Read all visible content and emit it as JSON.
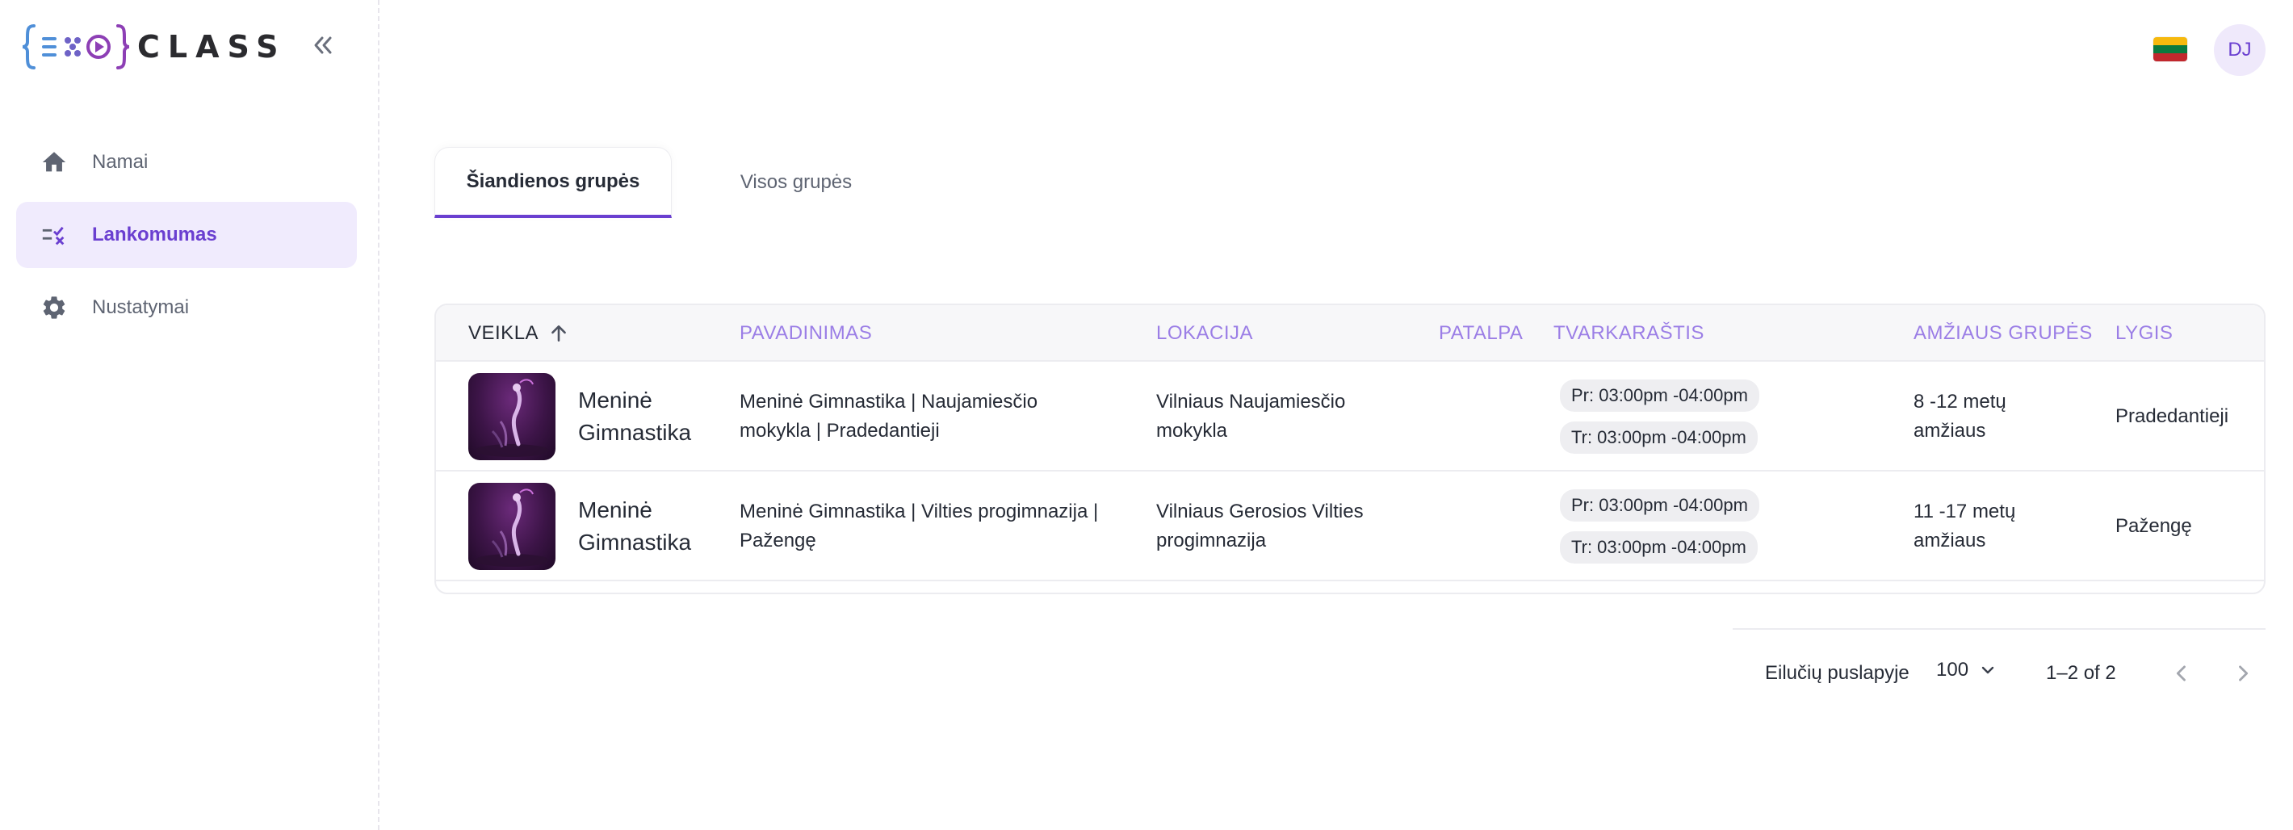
{
  "brand": {
    "logo_text": "CLASS",
    "colors": {
      "blue": "#4f8fd8",
      "purple": "#8d3fb5",
      "dark": "#2b2b2f"
    }
  },
  "sidebar": {
    "items": [
      {
        "label": "Namai",
        "icon": "home-icon",
        "active": false
      },
      {
        "label": "Lankomumas",
        "icon": "attendance-icon",
        "active": true
      },
      {
        "label": "Nustatymai",
        "icon": "gear-icon",
        "active": false
      }
    ]
  },
  "header": {
    "avatar_initials": "DJ",
    "flag": {
      "colors": [
        "#f6b90e",
        "#0a7a3f",
        "#c1272d"
      ]
    }
  },
  "tabs": [
    {
      "label": "Šiandienos grupės",
      "active": true
    },
    {
      "label": "Visos grupės",
      "active": false
    }
  ],
  "table": {
    "columns": [
      "VEIKLA",
      "PAVADINIMAS",
      "LOKACIJA",
      "PATALPA",
      "TVARKARAŠTIS",
      "AMŽIAUS GRUPĖS",
      "LYGIS"
    ],
    "rows": [
      {
        "activity": [
          "Meninė",
          "Gimnastika"
        ],
        "name": [
          "Meninė Gimnastika | Naujamiesčio",
          "mokykla | Pradedantieji"
        ],
        "location": [
          "Vilniaus Naujamiesčio",
          "mokykla"
        ],
        "room": "",
        "schedule": [
          "Pr: 03:00pm -04:00pm",
          "Tr: 03:00pm -04:00pm"
        ],
        "age": [
          "8 -12 metų",
          "amžiaus"
        ],
        "level": "Pradedantieji"
      },
      {
        "activity": [
          "Meninė",
          "Gimnastika"
        ],
        "name": [
          "Meninė Gimnastika | Vilties progimnazija |",
          "Pažengę"
        ],
        "location": [
          "Vilniaus Gerosios Vilties",
          "progimnazija"
        ],
        "room": "",
        "schedule": [
          "Pr: 03:00pm -04:00pm",
          "Tr: 03:00pm -04:00pm"
        ],
        "age": [
          "11 -17 metų",
          "amžiaus"
        ],
        "level": "Pažengę"
      }
    ]
  },
  "pagination": {
    "rows_label": "Eilučių puslapyje",
    "rows_per_page": "100",
    "range": "1–2 of 2"
  }
}
